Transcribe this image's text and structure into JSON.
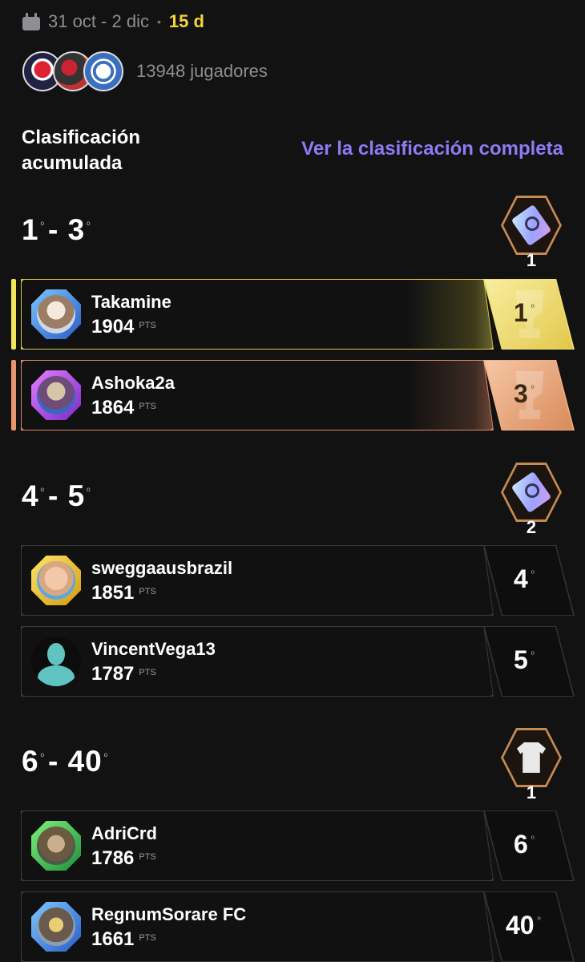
{
  "header": {
    "dates": "31 oct - 2 dic",
    "separator": "•",
    "days": "15 d"
  },
  "players": {
    "count_label": "13948 jugadores"
  },
  "section": {
    "title": "Clasificación acumulada",
    "link": "Ver la clasificación completa"
  },
  "ranges": [
    {
      "from": "1",
      "to": "3",
      "ordinal": "º",
      "dash": "-",
      "prize_icon": "ticket-icon",
      "prize_qty": "1"
    },
    {
      "from": "4",
      "to": "5",
      "ordinal": "º",
      "dash": "-",
      "prize_icon": "ticket-icon",
      "prize_qty": "2"
    },
    {
      "from": "6",
      "to": "40",
      "ordinal": "º",
      "dash": "-",
      "prize_icon": "jersey-icon",
      "prize_qty": "1"
    }
  ],
  "entries": [
    {
      "name": "Takamine",
      "points": "1904",
      "unit": "PTS",
      "rank": "1",
      "ordinal": "º"
    },
    {
      "name": "Ashoka2a",
      "points": "1864",
      "unit": "PTS",
      "rank": "3",
      "ordinal": "º"
    },
    {
      "name": "sweggaausbrazil",
      "points": "1851",
      "unit": "PTS",
      "rank": "4",
      "ordinal": "º"
    },
    {
      "name": "VincentVega13",
      "points": "1787",
      "unit": "PTS",
      "rank": "5",
      "ordinal": "º"
    },
    {
      "name": "AdriCrd",
      "points": "1786",
      "unit": "PTS",
      "rank": "6",
      "ordinal": "º"
    },
    {
      "name": "RegnumSorare FC",
      "points": "1661",
      "unit": "PTS",
      "rank": "40",
      "ordinal": "º"
    }
  ],
  "colors": {
    "accent_link": "#8c7cf4",
    "days": "#f5d33b",
    "gold": "#e2c84a",
    "bronze": "#d98a5b"
  }
}
